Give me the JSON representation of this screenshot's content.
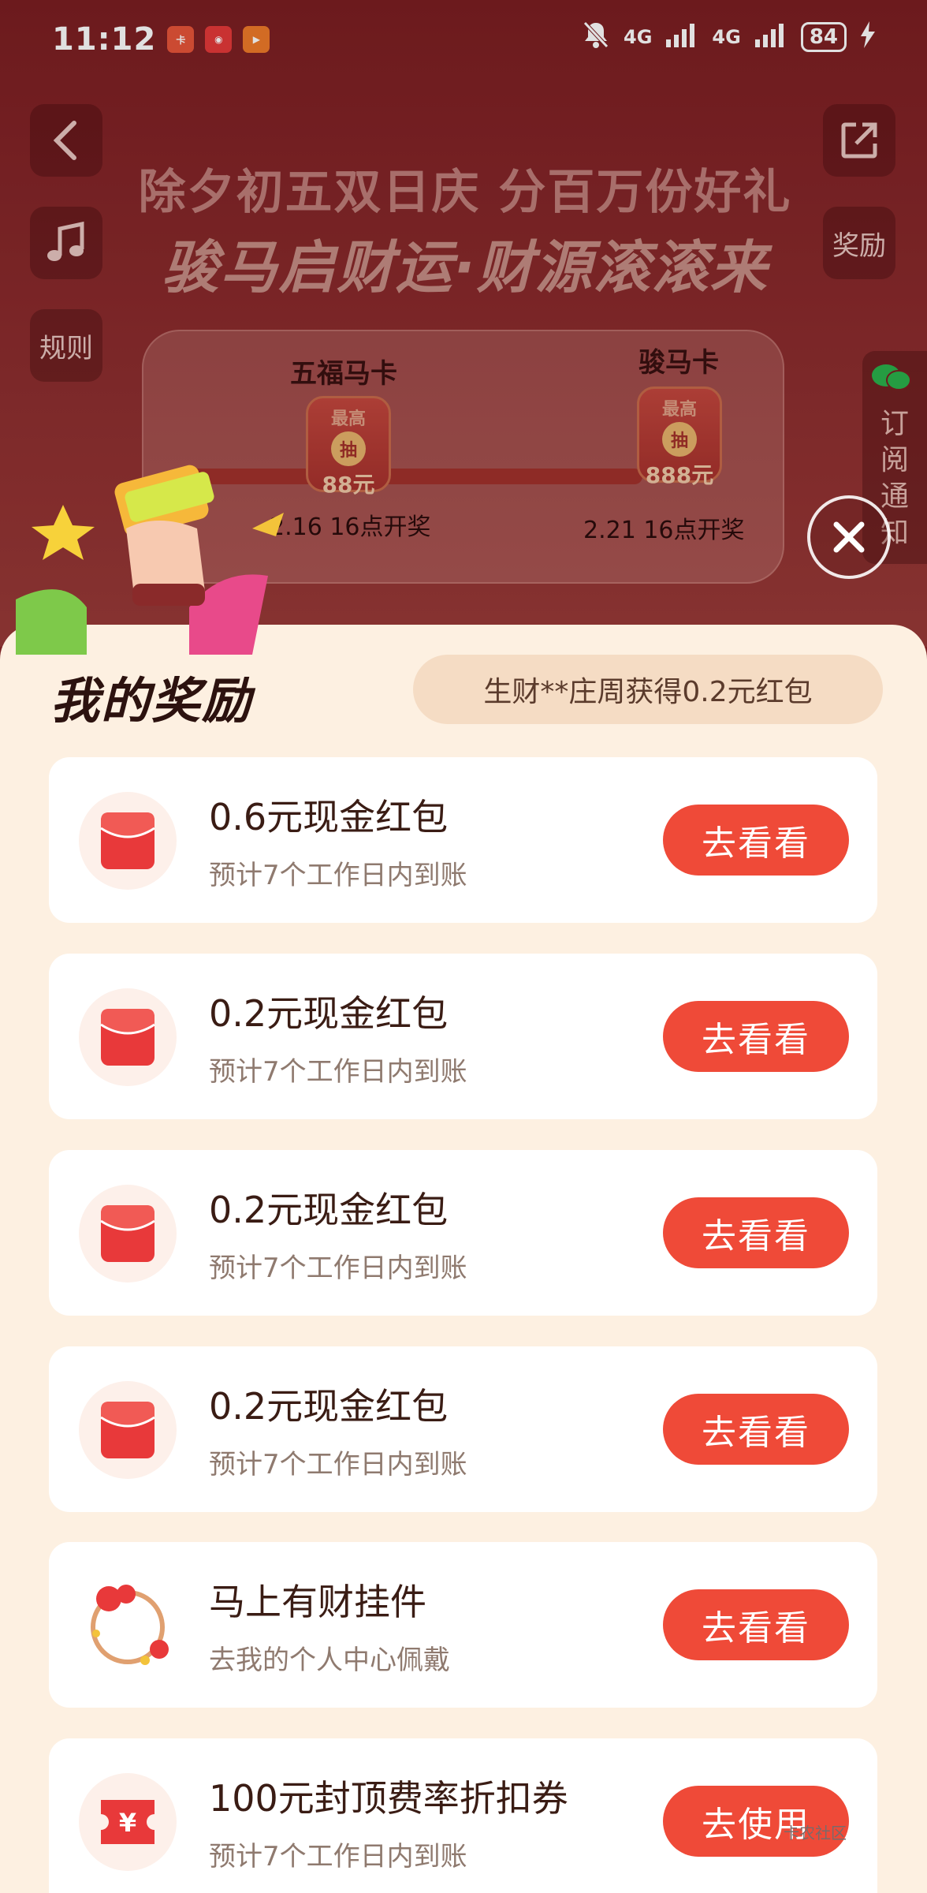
{
  "status_bar": {
    "time": "11:12",
    "app_icons": [
      {
        "name": "app-icon-1",
        "color": "#e8553a"
      },
      {
        "name": "app-icon-2",
        "color": "#e53a3a"
      },
      {
        "name": "app-icon-3",
        "color": "#f07a2a"
      }
    ],
    "network_1": "4G",
    "network_2": "4G",
    "battery": "84"
  },
  "header": {
    "back_icon": "chevron-left-icon",
    "share_icon": "share-icon",
    "music_icon": "music-icon",
    "reward_label": "奖励",
    "rules_label": "规则",
    "headline_line1": "除夕初五双日庆 分百万份好礼",
    "headline_line2": "骏马启财运·财源滚滚来"
  },
  "cards": {
    "card1": {
      "name": "五福马卡",
      "badge_top": "最高",
      "badge_mid": "抽",
      "amount": "88元",
      "draw_time": "2.16 16点开奖"
    },
    "card2": {
      "name": "骏马卡",
      "badge_top": "最高",
      "badge_mid": "抽",
      "amount": "888元",
      "draw_time": "2.21 16点开奖"
    }
  },
  "subscribe": {
    "label_chars": [
      "订",
      "阅",
      "通",
      "知"
    ]
  },
  "sheet": {
    "title": "我的奖励",
    "ticker": "生财**庄周获得0.2元红包",
    "rewards": [
      {
        "icon": "red-envelope-icon",
        "title": "0.6元现金红包",
        "subtitle": "预计7个工作日内到账",
        "button": "去看看"
      },
      {
        "icon": "red-envelope-icon",
        "title": "0.2元现金红包",
        "subtitle": "预计7个工作日内到账",
        "button": "去看看"
      },
      {
        "icon": "red-envelope-icon",
        "title": "0.2元现金红包",
        "subtitle": "预计7个工作日内到账",
        "button": "去看看"
      },
      {
        "icon": "red-envelope-icon",
        "title": "0.2元现金红包",
        "subtitle": "预计7个工作日内到账",
        "button": "去看看"
      },
      {
        "icon": "bracelet-pendant-icon",
        "title": "马上有财挂件",
        "subtitle": "去我的个人中心佩戴",
        "button": "去看看"
      },
      {
        "icon": "coupon-icon",
        "title": "100元封顶费率折扣券",
        "subtitle": "预计7个工作日内到账",
        "button": "去使用"
      }
    ]
  },
  "watermark": "卡农社区",
  "colors": {
    "accent": "#ef4a38",
    "sheet_bg": "#fdf0e1",
    "header_bg": "#7c1e22"
  }
}
